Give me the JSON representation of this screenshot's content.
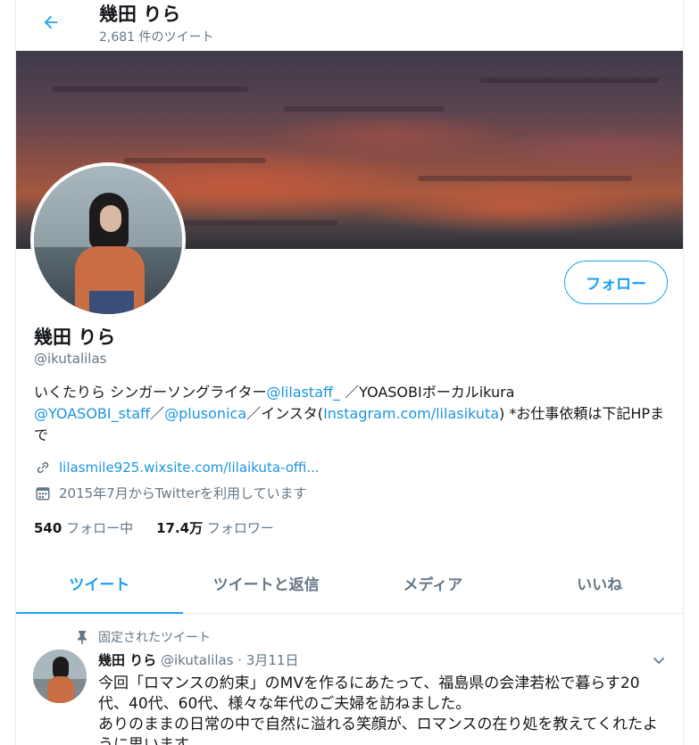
{
  "header": {
    "title": "幾田 りら",
    "tweet_count": "2,681 件のツイート"
  },
  "profile": {
    "follow_label": "フォロー",
    "name": "幾田 りら",
    "handle": "@ikutalilas",
    "bio": {
      "part1": "いくたりら シンガーソングライター",
      "link1": "@lilastaff_",
      "part2": " ／YOASOBIボーカルikura",
      "link2": "@YOASOBI_staff",
      "part3": "／",
      "link3": "@plusonica",
      "part4": "／インスタ(",
      "link4": "Instagram.com/lilasikuta",
      "part5": ") *お仕事依頼は下記HPまで"
    },
    "website": "lilasmile925.wixsite.com/lilaikuta-offi...",
    "joined": "2015年7月からTwitterを利用しています",
    "following_count": "540",
    "following_label": "フォロー中",
    "followers_count": "17.4万",
    "followers_label": "フォロワー"
  },
  "tabs": [
    {
      "label": "ツイート",
      "active": true
    },
    {
      "label": "ツイートと返信",
      "active": false
    },
    {
      "label": "メディア",
      "active": false
    },
    {
      "label": "いいね",
      "active": false
    }
  ],
  "tweet": {
    "pinned_label": "固定されたツイート",
    "name": "幾田 りら",
    "handle": "@ikutalilas",
    "sep": "·",
    "date": "3月11日",
    "line1": "今回「ロマンスの約束」のMVを作るにあたって、福島県の会津若松で暮らす20代、40代、60代、様々な年代のご夫婦を訪ねました。",
    "line2": "ありのままの日常の中で自然に溢れる笑顔が、ロマンスの在り処を教えてくれたように思います。"
  },
  "colors": {
    "accent": "#1da1f2",
    "link": "#1b95e0",
    "secondary_text": "#657786",
    "border": "#e6ecf0"
  },
  "icons": [
    "back-arrow-icon",
    "link-icon",
    "calendar-icon",
    "pin-icon",
    "chevron-down-icon"
  ]
}
